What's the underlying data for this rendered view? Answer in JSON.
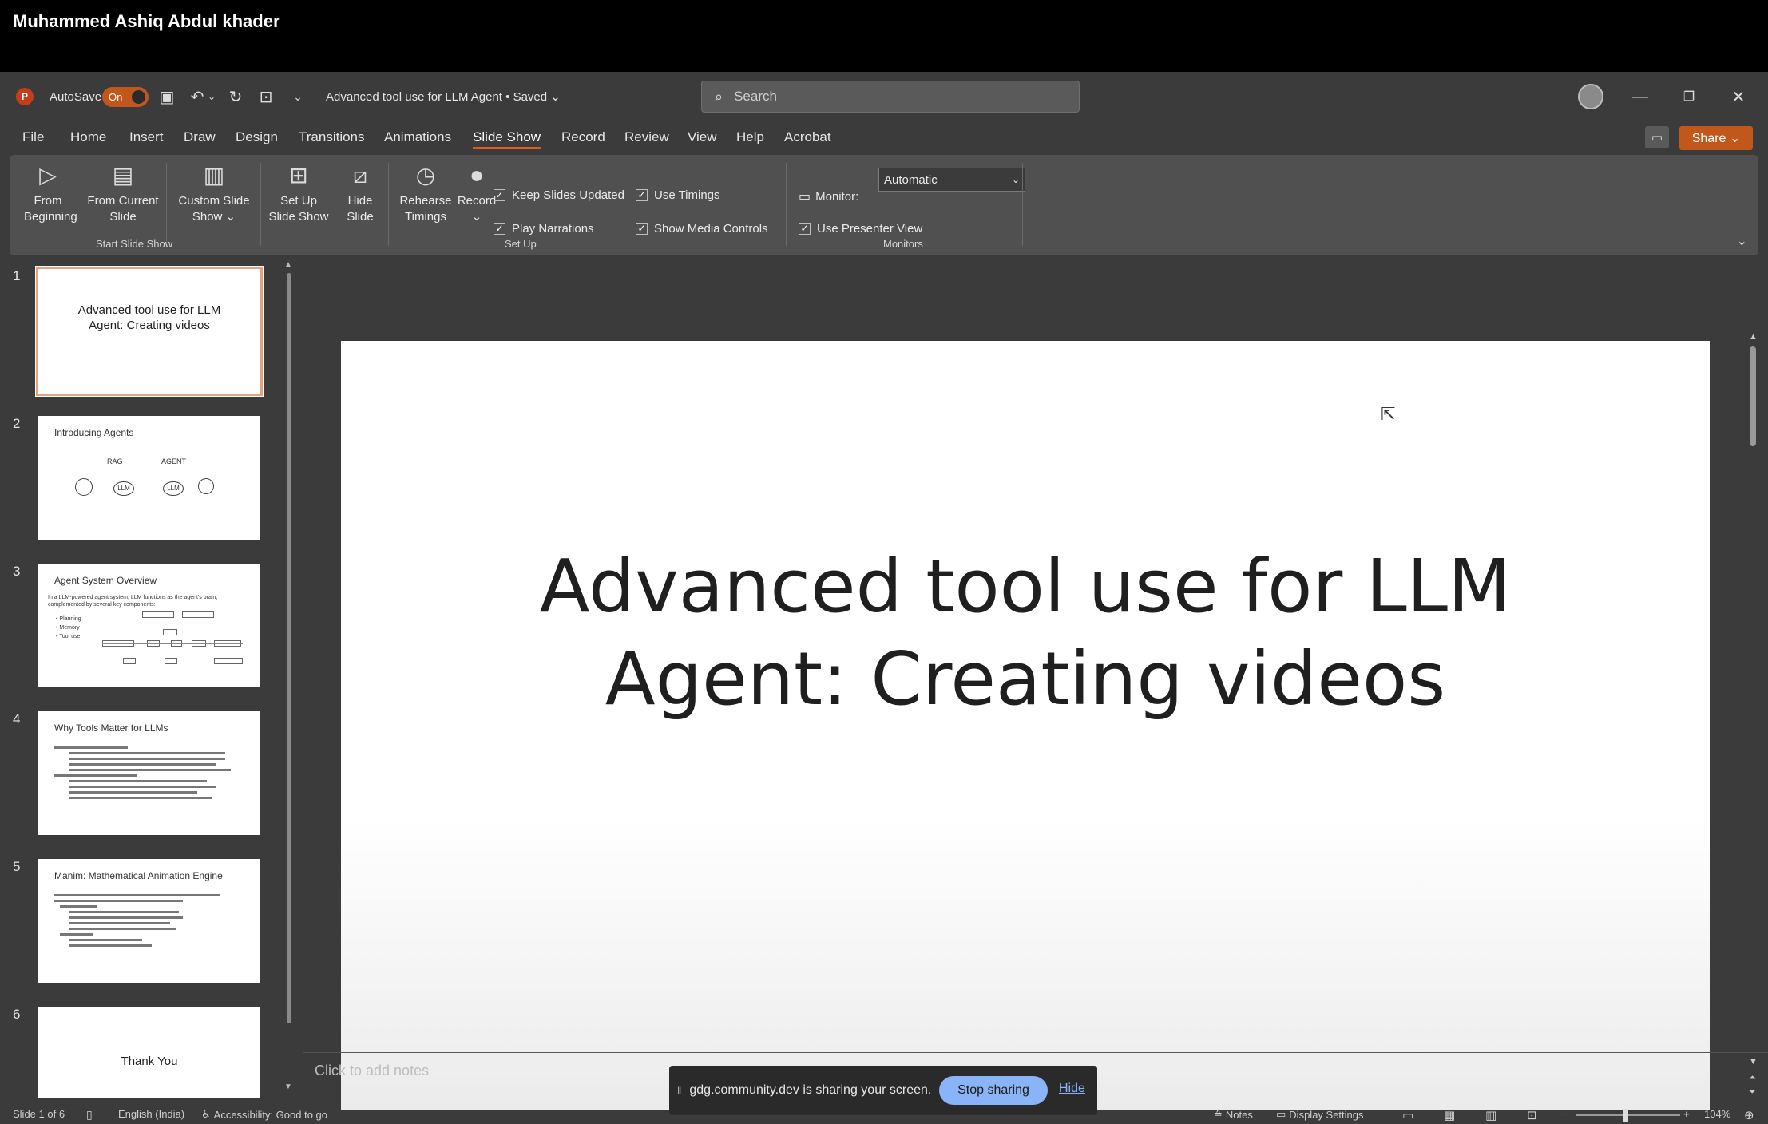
{
  "presenter": {
    "name": "Muhammed Ashiq Abdul khader"
  },
  "titlebar": {
    "app_logo": "P",
    "autosave_label": "AutoSave",
    "autosave_state": "On",
    "document_title": "Advanced tool use for LLM Agent • Saved ⌄",
    "search_placeholder": "Search",
    "accent_color": "#c2571b"
  },
  "menu": {
    "tabs": [
      "File",
      "Home",
      "Insert",
      "Draw",
      "Design",
      "Transitions",
      "Animations",
      "Slide Show",
      "Record",
      "Review",
      "View",
      "Help",
      "Acrobat"
    ],
    "active_tab": "Slide Show",
    "share_label": "Share ⌄"
  },
  "ribbon": {
    "from_beginning": "From Beginning",
    "from_current": "From Current Slide",
    "custom_show": "Custom Slide Show ⌄",
    "group_start": "Start Slide Show",
    "setup_show": "Set Up Slide Show",
    "hide_slide": "Hide Slide",
    "rehearse": "Rehearse Timings",
    "record": "Record",
    "record_caret": "⌄",
    "keep_updated": "Keep Slides Updated",
    "play_narrations": "Play Narrations",
    "use_timings": "Use Timings",
    "show_media": "Show Media Controls",
    "group_setup": "Set Up",
    "monitor_label": "Monitor:",
    "monitor_value": "Automatic",
    "presenter_view": "Use Presenter View",
    "group_monitors": "Monitors"
  },
  "thumbnails": [
    {
      "num": "1",
      "title": "Advanced tool use for LLM Agent: Creating videos"
    },
    {
      "num": "2",
      "title": "Introducing Agents",
      "labels": [
        "RAG",
        "AGENT",
        "LLM",
        "LLM"
      ]
    },
    {
      "num": "3",
      "title": "Agent System Overview",
      "body": "In a LLM-powered agent system, LLM functions as the agent's brain, complemented by several key components:",
      "bullets": [
        "Planning",
        "Memory",
        "Tool use"
      ]
    },
    {
      "num": "4",
      "title": "Why Tools Matter for LLMs"
    },
    {
      "num": "5",
      "title": "Manim: Mathematical Animation Engine"
    },
    {
      "num": "6",
      "title": "Thank You"
    }
  ],
  "slide": {
    "title_line1": "Advanced tool use for LLM",
    "title_line2": "Agent: Creating videos"
  },
  "notes": {
    "placeholder": "Click to add notes"
  },
  "screen_share": {
    "message": "gdg.community.dev is sharing your screen.",
    "stop_label": "Stop sharing",
    "hide_label": "Hide"
  },
  "statusbar": {
    "slide_info": "Slide 1 of 6",
    "language": "English (India)",
    "accessibility": "Accessibility: Good to go",
    "notes": "Notes",
    "display_settings": "Display Settings",
    "zoom": "104%"
  }
}
